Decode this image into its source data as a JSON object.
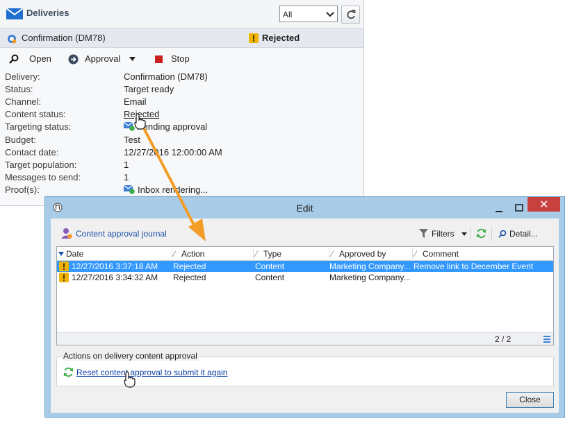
{
  "panel": {
    "title": "Deliveries",
    "filter_value": "All",
    "delivery_name": "Confirmation (DM78)",
    "delivery_state": "Rejected",
    "toolbar": {
      "open": "Open",
      "approval": "Approval",
      "stop": "Stop"
    },
    "properties": [
      {
        "label": "Delivery:",
        "value": "Confirmation (DM78)"
      },
      {
        "label": "Status:",
        "value": "Target ready"
      },
      {
        "label": "Channel:",
        "value": "Email"
      },
      {
        "label": "Content status:",
        "value": "Rejected"
      },
      {
        "label": "Targeting status:",
        "value": "Pending approval"
      },
      {
        "label": "Budget:",
        "value": "Test"
      },
      {
        "label": "Contact date:",
        "value": "12/27/2016 12:00:00 AM"
      },
      {
        "label": "Target population:",
        "value": "1"
      },
      {
        "label": "Messages to send:",
        "value": "1"
      },
      {
        "label": "Proof(s):",
        "value": "Inbox rendering..."
      }
    ]
  },
  "dialog": {
    "title": "Edit",
    "journal_title": "Content approval journal",
    "filters_label": "Filters",
    "detail_label": "Detail...",
    "columns": [
      "Date",
      "Action",
      "Type",
      "Approved by",
      "Comment"
    ],
    "rows": [
      {
        "date": "12/27/2016 3:37:18 AM",
        "action": "Rejected",
        "type": "Content",
        "approved_by": "Marketing Company...",
        "comment": "Remove link to December Event"
      },
      {
        "date": "12/27/2016 3:34:32 AM",
        "action": "Rejected",
        "type": "Content",
        "approved_by": "Marketing Company...",
        "comment": ""
      }
    ],
    "row_count": "2 / 2",
    "actions_legend": "Actions on delivery content approval",
    "reset_link": "Reset content approval to submit it again",
    "close_button": "Close"
  },
  "colors": {
    "accent": "#f39c26",
    "selection": "#3399ff",
    "link": "#0b3fa8",
    "stop": "#cc1f1f",
    "warning": "#f0b400"
  }
}
